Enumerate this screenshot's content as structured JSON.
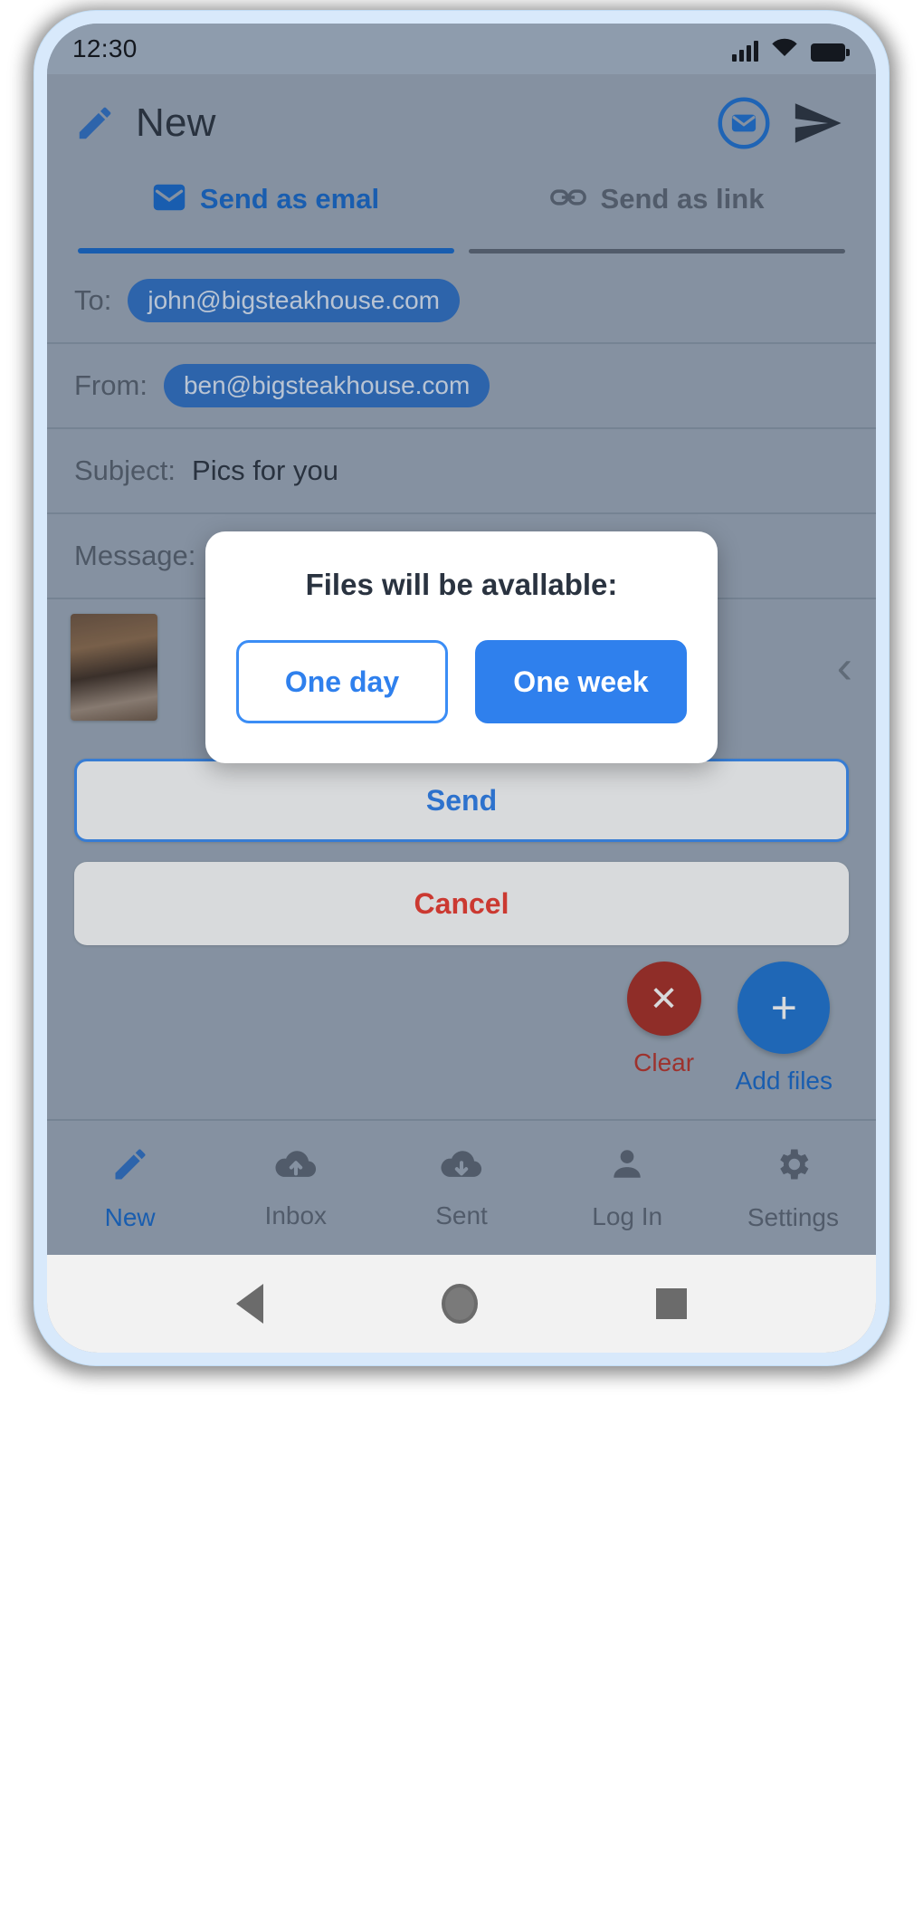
{
  "status_bar": {
    "time": "12:30",
    "signal_icon": "cellular-signal-icon",
    "wifi_icon": "wifi-icon",
    "battery_icon": "battery-full-icon"
  },
  "app_bar": {
    "compose_icon": "pencil-icon",
    "title": "New",
    "message_icon": "message-circle-icon",
    "send_icon": "send-paper-plane-icon"
  },
  "tabs": [
    {
      "label": "Send as emal",
      "icon": "envelope-icon",
      "active": true
    },
    {
      "label": "Send as link",
      "icon": "link-chain-icon",
      "active": false
    }
  ],
  "form": {
    "to": {
      "label": "To:",
      "value": "john@bigsteakhouse.com"
    },
    "from": {
      "label": "From:",
      "value": "ben@bigsteakhouse.com"
    },
    "subject": {
      "label": "Subject:",
      "value": "Pics for you"
    },
    "message": {
      "label": "Message:",
      "value": ""
    }
  },
  "attachments": {
    "next_icon": "chevron-left-icon"
  },
  "dialog": {
    "title": "Files will be avallable:",
    "options": [
      {
        "label": "One day",
        "selected": false
      },
      {
        "label": "One week",
        "selected": true
      }
    ]
  },
  "actions": {
    "send_label": "Send",
    "cancel_label": "Cancel"
  },
  "fabs": {
    "clear": {
      "icon": "close-x-icon",
      "label": "Clear"
    },
    "add_files": {
      "icon": "plus-icon",
      "label": "Add files"
    }
  },
  "bottom_nav": [
    {
      "label": "New",
      "icon": "pencil-icon",
      "active": true
    },
    {
      "label": "Inbox",
      "icon": "cloud-upload-icon",
      "active": false
    },
    {
      "label": "Sent",
      "icon": "cloud-download-icon",
      "active": false
    },
    {
      "label": "Log In",
      "icon": "person-icon",
      "active": false
    },
    {
      "label": "Settings",
      "icon": "gear-icon",
      "active": false
    }
  ],
  "system_nav": {
    "back_icon": "android-back-icon",
    "home_icon": "android-home-icon",
    "recents_icon": "android-recents-icon"
  },
  "colors": {
    "accent_blue": "#2f80ed",
    "tab_blue": "#1667c8",
    "danger_red": "#ef3b2f",
    "clear_red": "#a62c24",
    "screen_bg": "#9aa7b7",
    "phone_frame": "#d8e9fb"
  }
}
